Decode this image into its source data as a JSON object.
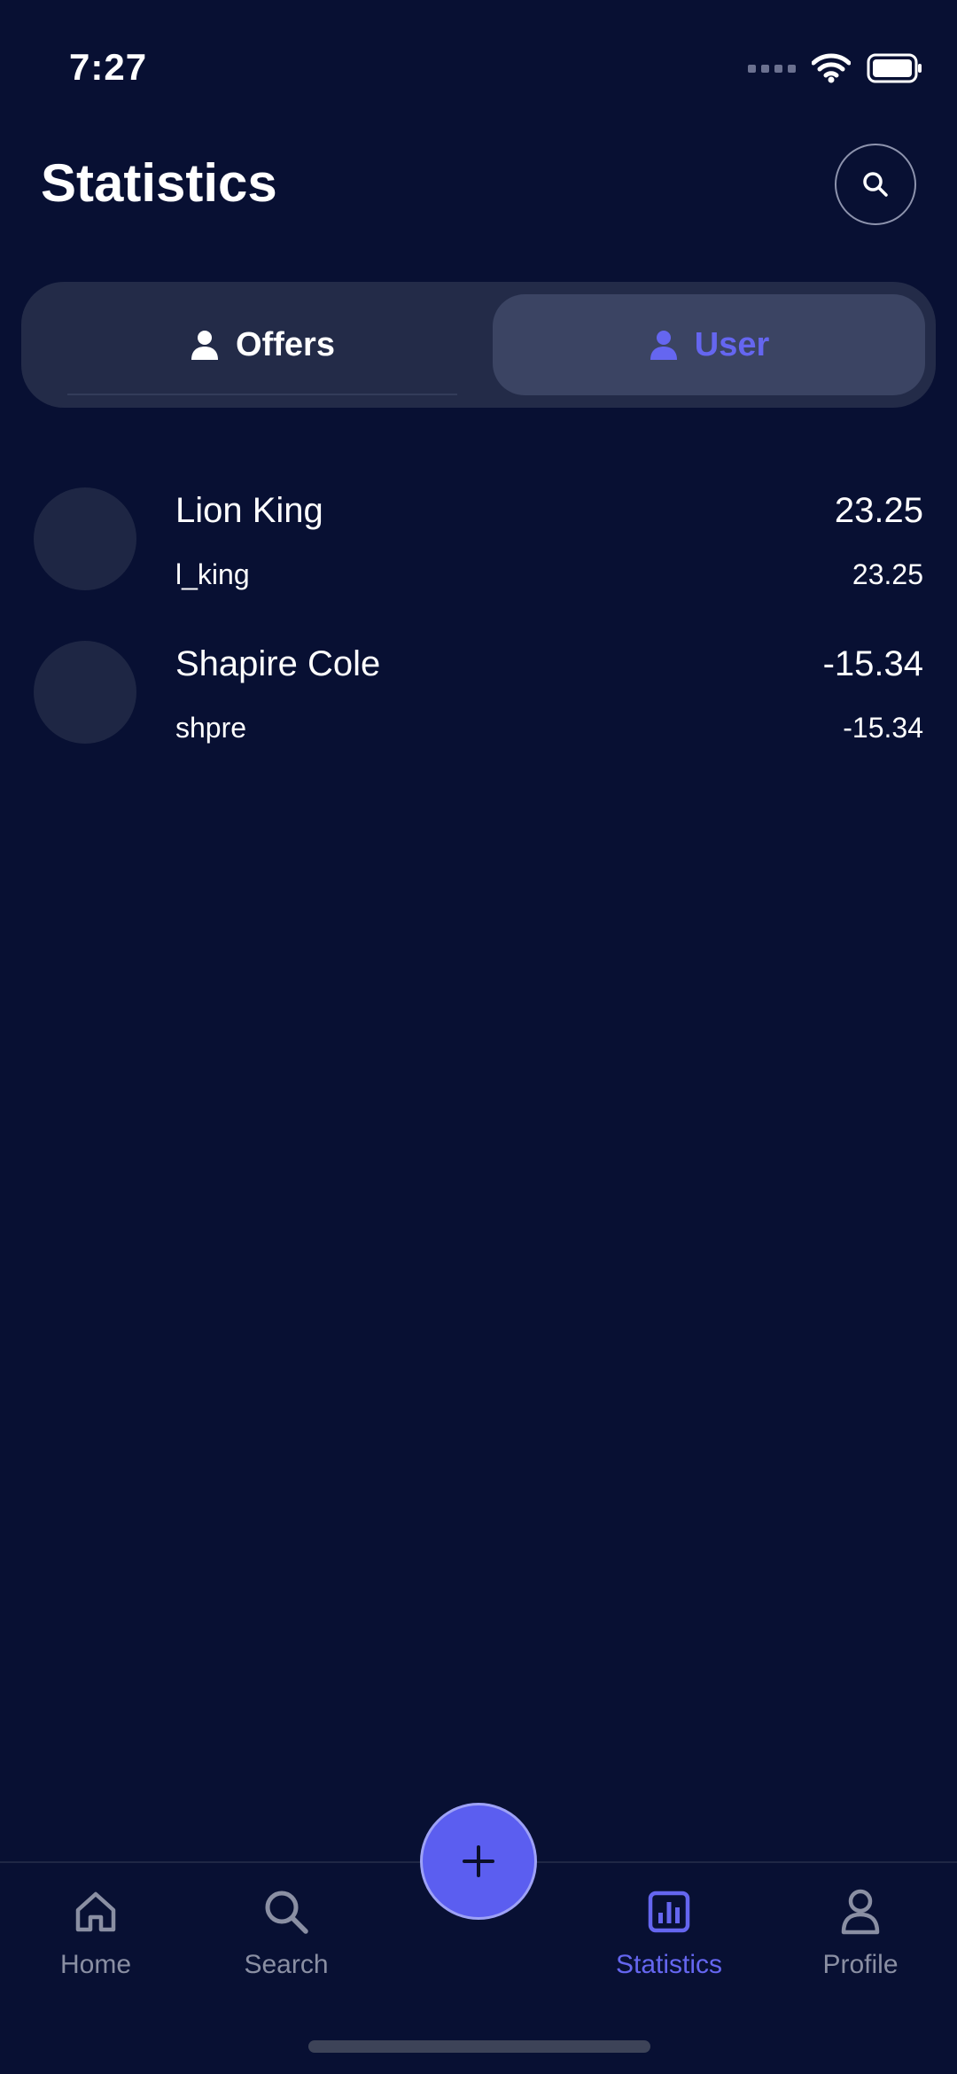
{
  "status_bar": {
    "time": "7:27"
  },
  "header": {
    "title": "Statistics"
  },
  "segments": {
    "offers_label": "Offers",
    "user_label": "User"
  },
  "list": [
    {
      "name": "Lion King",
      "handle": "l_king",
      "value": "23.25",
      "subvalue": "23.25"
    },
    {
      "name": "Shapire Cole",
      "handle": "shpre",
      "value": "-15.34",
      "subvalue": "-15.34"
    }
  ],
  "bottom_nav": {
    "items": [
      {
        "label": "Home",
        "icon": "home-icon"
      },
      {
        "label": "Search",
        "icon": "search-icon"
      },
      {
        "label": "Statistics",
        "icon": "statistics-icon"
      },
      {
        "label": "Profile",
        "icon": "profile-icon"
      }
    ],
    "fab_icon": "plus-icon"
  },
  "colors": {
    "background": "#081033",
    "accent": "#6566f0",
    "fab": "#5b5ef0",
    "inactive": "#8a8fa3"
  }
}
